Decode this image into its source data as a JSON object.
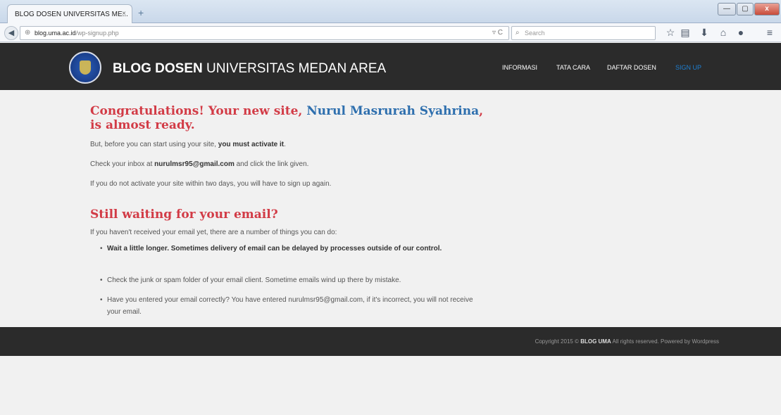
{
  "browser": {
    "tab_title": "BLOG DOSEN UNIVERSITAS ME...",
    "tab_close": "×",
    "new_tab": "+",
    "window_controls": {
      "minimize": "—",
      "maximize": "▢",
      "close": "x"
    },
    "url_host": "blog.uma.ac.id",
    "url_path": "/wp-signup.php",
    "search_placeholder": "Search",
    "toolbar_icons": [
      "star-icon",
      "bookmarks-icon",
      "download-icon",
      "home-icon",
      "chat-icon",
      "menu-icon"
    ]
  },
  "header": {
    "title_bold": "BLOG DOSEN",
    "title_rest": " UNIVERSITAS MEDAN AREA",
    "menu": [
      "INFORMASI",
      "TATA CARA",
      "DAFTAR DOSEN",
      "SIGN UP"
    ]
  },
  "main": {
    "heading_pre": "Congratulations! Your new site, ",
    "heading_name": "Nurul Masrurah Syahrina",
    "heading_post1": ",",
    "heading_post2": "is almost ready.",
    "para1_pre": "But, before you can start using your site, ",
    "para1_bold": "you must activate it",
    "para1_post": ".",
    "para2_pre": "Check your inbox at ",
    "para2_email": "nurulmsr95@gmail.com",
    "para2_post": " and click the link given.",
    "para3": "If you do not activate your site within two days, you will have to sign up again.",
    "heading2": "Still waiting for your email?",
    "para4": "If you haven't received your email yet, there are a number of things you can do:",
    "bullet1": "Wait a little longer. Sometimes delivery of email can be delayed by processes outside of our control.",
    "bullet2": "Check the junk or spam folder of your email client. Sometime emails wind up there by mistake.",
    "bullet3": "Have you entered your email correctly? You have entered nurulmsr95@gmail.com, if it's incorrect, you will not receive your email."
  },
  "footer": {
    "copyright_pre": "Copyright 2015 © ",
    "copyright_brand": "BLOG UMA",
    "copyright_post": " All rights reserved. Powered by Wordpress"
  },
  "colors": {
    "accent_red": "#d23b46",
    "accent_blue": "#2e6fae",
    "signup_blue": "#1e7fd2",
    "header_bg": "#2b2b2b"
  }
}
